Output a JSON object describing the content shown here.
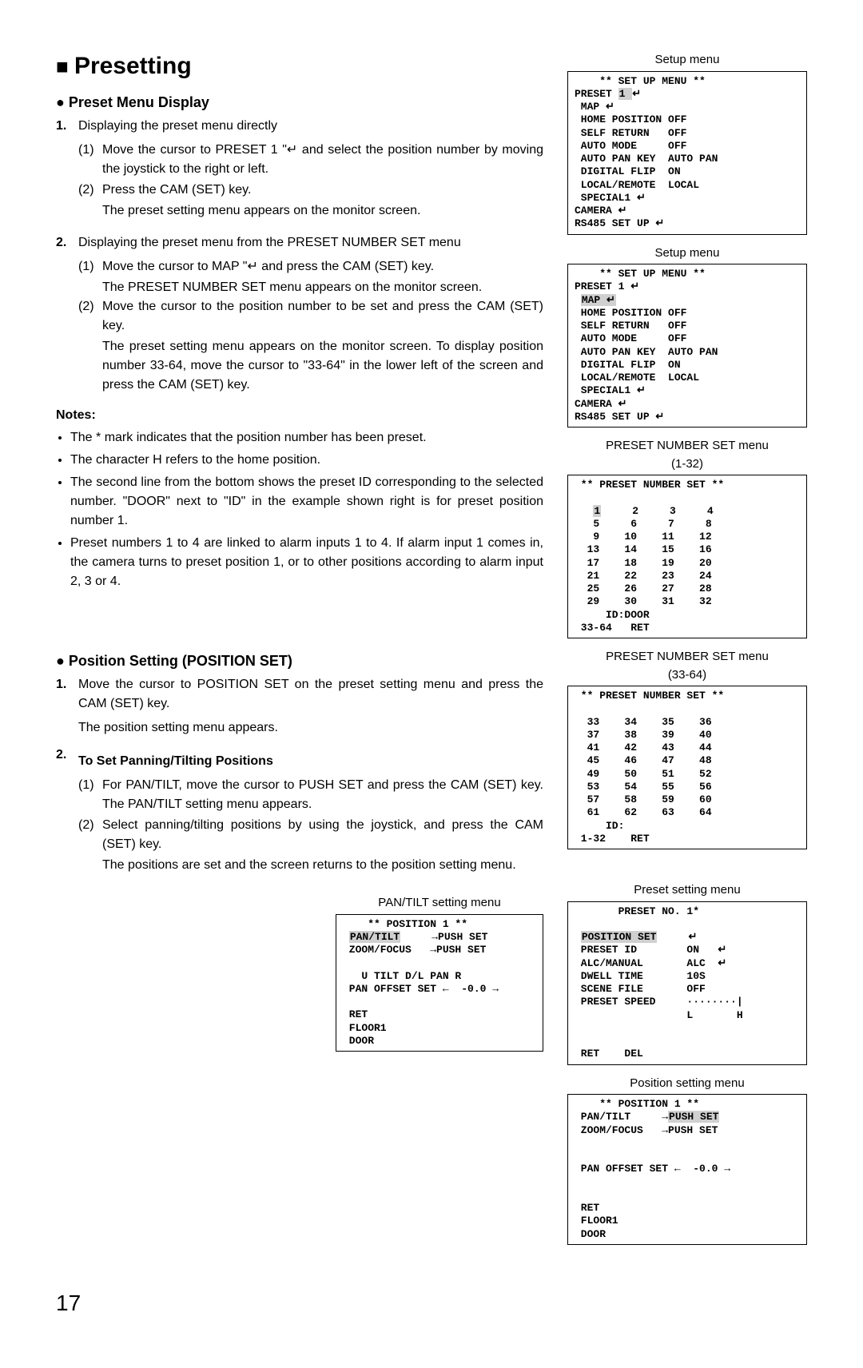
{
  "page_number": "17",
  "title": "Presetting",
  "sec1": {
    "heading": "Preset Menu Display",
    "item1": {
      "num": "1.",
      "text": "Displaying the preset menu directly",
      "p1": {
        "num": "(1)",
        "text": "Move the cursor to PRESET 1 \"↵ and select the position number by moving the joystick to the right or left."
      },
      "p2": {
        "num": "(2)",
        "text": "Press the CAM (SET) key."
      },
      "p2b": "The preset setting menu appears on the monitor screen."
    },
    "item2": {
      "num": "2.",
      "text": "Displaying the preset menu from the PRESET NUMBER SET menu",
      "p1": {
        "num": "(1)",
        "text": "Move the cursor to MAP \"↵ and press the CAM (SET) key."
      },
      "p1b": "The PRESET NUMBER SET menu appears on the monitor screen.",
      "p2": {
        "num": "(2)",
        "text": "Move the cursor to the position number to be set and press the CAM (SET) key."
      },
      "p2b": "The preset setting menu appears on the monitor screen. To display position number 33-64, move the cursor to \"33-64\" in the lower left of the screen and press the CAM (SET) key."
    },
    "notes_hdr": "Notes:",
    "notes": [
      "The * mark indicates that the position number has been preset.",
      "The character H refers to the home position.",
      "The second line from the bottom shows the preset ID corresponding to the selected number. \"DOOR\" next to \"ID\" in the example shown right is for preset position number 1.",
      "Preset numbers 1 to 4 are linked to alarm inputs 1 to 4. If alarm input 1 comes in, the camera turns to preset position 1, or to other positions according to alarm input 2, 3 or 4."
    ]
  },
  "sec2": {
    "heading": "Position Setting (POSITION SET)",
    "item1": {
      "num": "1.",
      "text": "Move the cursor to POSITION SET on the preset setting menu and press the CAM (SET) key.",
      "text2": "The position setting menu appears."
    },
    "item2": {
      "num": "2.",
      "text": "To Set Panning/Tilting Positions",
      "p1": {
        "num": "(1)",
        "text": "For PAN/TILT, move the cursor to PUSH SET and press the CAM (SET) key. The PAN/TILT setting menu appears."
      },
      "p2": {
        "num": "(2)",
        "text": "Select panning/tilting positions by using the joystick, and press the CAM (SET) key."
      },
      "p2b": "The positions are set and the screen returns to the position setting menu."
    }
  },
  "side": {
    "setup_label": "Setup menu",
    "preset_label_a": "PRESET NUMBER SET menu",
    "preset_range_a": "(1-32)",
    "preset_label_b": "PRESET NUMBER SET menu",
    "preset_range_b": "(33-64)",
    "preset_setting_label": "Preset setting menu",
    "position_setting_label": "Position setting menu",
    "pantilt_label": "PAN/TILT setting menu"
  },
  "osd": {
    "setup1_l1": "    ** SET UP MENU **",
    "setup1_l2a": "PRESET ",
    "setup1_l2b": "1 ",
    "setup1_l2c": "↵",
    "setup1_l3": " MAP ↵",
    "setup1_l4": " HOME POSITION OFF",
    "setup1_l5": " SELF RETURN   OFF",
    "setup1_l6": " AUTO MODE     OFF",
    "setup1_l7": " AUTO PAN KEY  AUTO PAN",
    "setup1_l8": " DIGITAL FLIP  ON",
    "setup1_l9": " LOCAL/REMOTE  LOCAL",
    "setup1_l10": " SPECIAL1 ↵",
    "setup1_l11": "CAMERA ↵",
    "setup1_l12": "RS485 SET UP ↵",
    "setup2_l1": "    ** SET UP MENU **",
    "setup2_l2": "PRESET 1 ↵",
    "setup2_l3a": " ",
    "setup2_l3b": "MAP ↵",
    "setup2_l4": " HOME POSITION OFF",
    "setup2_l5": " SELF RETURN   OFF",
    "setup2_l6": " AUTO MODE     OFF",
    "setup2_l7": " AUTO PAN KEY  AUTO PAN",
    "setup2_l8": " DIGITAL FLIP  ON",
    "setup2_l9": " LOCAL/REMOTE  LOCAL",
    "setup2_l10": " SPECIAL1 ↵",
    "setup2_l11": "CAMERA ↵",
    "setup2_l12": "RS485 SET UP ↵",
    "pna_title": " ** PRESET NUMBER SET **",
    "pna_r1a": "   ",
    "pna_r1b": "1",
    "pna_r1c": "     2     3     4",
    "pna_r2": "   5     6     7     8",
    "pna_r3": "   9    10    11    12",
    "pna_r4": "  13    14    15    16",
    "pna_r5": "  17    18    19    20",
    "pna_r6": "  21    22    23    24",
    "pna_r7": "  25    26    27    28",
    "pna_r8": "  29    30    31    32",
    "pna_id": "     ID:DOOR",
    "pna_ft": " 33-64   RET",
    "pnb_title": " ** PRESET NUMBER SET **",
    "pnb_r1": "  33    34    35    36",
    "pnb_r2": "  37    38    39    40",
    "pnb_r3": "  41    42    43    44",
    "pnb_r4": "  45    46    47    48",
    "pnb_r5": "  49    50    51    52",
    "pnb_r6": "  53    54    55    56",
    "pnb_r7": "  57    58    59    60",
    "pnb_r8": "  61    62    63    64",
    "pnb_id": "     ID:",
    "pnb_ft": " 1-32    RET",
    "ps_title": "       PRESET NO. 1*",
    "ps_l1a": " ",
    "ps_l1b": "POSITION SET",
    "ps_l1c": "     ↵",
    "ps_l2": " PRESET ID        ON   ↵",
    "ps_l3": " ALC/MANUAL       ALC  ↵",
    "ps_l4": " DWELL TIME       10S",
    "ps_l5": " SCENE FILE       OFF",
    "ps_l6": " PRESET SPEED     ········|",
    "ps_l7": "                  L       H",
    "ps_ret": " RET    DEL",
    "pt_title": "    ** POSITION 1 **",
    "pt_l1a": " ",
    "pt_l1b": "PAN/TILT",
    "pt_l1c": "     →PUSH SET",
    "pt_l2": " ZOOM/FOCUS   →PUSH SET",
    "pt_blank": " ",
    "pt_l3": "   U TILT D/L PAN R",
    "pt_l4": " PAN OFFSET SET ←  -0.0 →",
    "pt_ret": " RET",
    "pt_fl": " FLOOR1",
    "pt_dr": " DOOR",
    "pos_title": "    ** POSITION 1 **",
    "pos_l1": " PAN/TILT     →",
    "pos_l1b": "PUSH SET",
    "pos_l2": " ZOOM/FOCUS   →PUSH SET",
    "pos_l4": " PAN OFFSET SET ←  -0.0 →",
    "pos_ret": " RET",
    "pos_fl": " FLOOR1",
    "pos_dr": " DOOR"
  }
}
